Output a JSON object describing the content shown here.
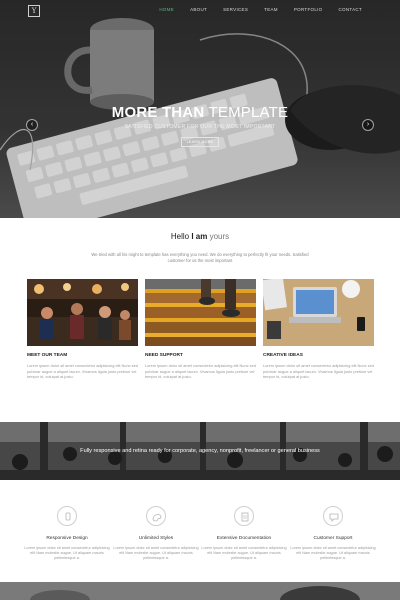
{
  "header": {
    "logo": "Y",
    "nav": [
      "HOME",
      "ABOUT",
      "SERVICES",
      "TEAM",
      "PORTFOLIO",
      "CONTACT"
    ],
    "active_nav": "HOME",
    "accent_color": "#4fbf8a"
  },
  "hero": {
    "title_bold": "MORE THAN",
    "title_light": "TEMPLATE",
    "subtitle": "SATISFIED CUSTOMER FOR OUR THE MOST IMPORTANT",
    "button_label": "LEARN MORE",
    "prev_icon": "chevron-left-icon",
    "next_icon": "chevron-right-icon"
  },
  "intro": {
    "greeting": "Hello",
    "bold": "I am",
    "light": "yours",
    "text": "We tried with all his might to template has everything you need. We do everything to perfectly fit your needs. Satisfied customer for us the most important"
  },
  "cards": [
    {
      "title": "MEET OUR TEAM",
      "text": "Lorem ipsum dolor sit amet consectetur adipisicing elit Nunc sed pulvinar augue a aliquet lacum. Vivamus ligula justo pretium vel tempor id, volutpat at justo."
    },
    {
      "title": "NEED SUPPORT",
      "text": "Lorem ipsum dolor sit amet consectetur adipisicing elit Nunc sed pulvinar augue a aliquet lacum. Vivamus ligula justo pretium vel tempor id, volutpat at justo."
    },
    {
      "title": "CREATIVE IDEAS",
      "text": "Lorem ipsum dolor sit amet consectetur adipisicing elit Nunc sed pulvinar augue a aliquet lacum. Vivamus ligula justo pretium vel tempor id, volutpat at justo."
    }
  ],
  "band": {
    "text": "Fully responsive and retina ready for corporate, agency, nonprofit, freelancer or general business"
  },
  "features": [
    {
      "title": "Responsive Design",
      "icon": "mobile-icon",
      "text": "Lorem ipsum dolor sit amet consectetur adipisicing elit Nam molestie augue. Ut aliquam mauris pellentesque a."
    },
    {
      "title": "Unlimited Styles",
      "icon": "palette-icon",
      "text": "Lorem ipsum dolor sit amet consectetur adipisicing elit Nam molestie augue. Ut aliquam mauris pellentesque a."
    },
    {
      "title": "Extensive Documentation",
      "icon": "document-icon",
      "text": "Lorem ipsum dolor sit amet consectetur adipisicing elit Nam molestie augue. Ut aliquam mauris pellentesque a."
    },
    {
      "title": "Customer Support",
      "icon": "chat-icon",
      "text": "Lorem ipsum dolor sit amet consectetur adipisicing elit Nam molestie augue. Ut aliquam mauris pellentesque a."
    }
  ]
}
